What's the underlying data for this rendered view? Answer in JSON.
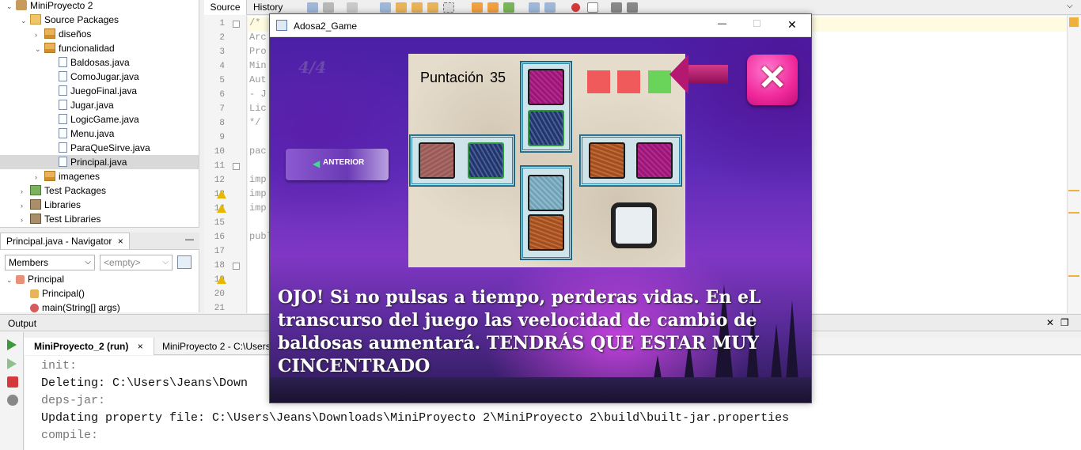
{
  "project_tree": {
    "items": [
      {
        "label": "MiniProyecto 2",
        "level": 0,
        "icon": "project-icon",
        "expanded": true
      },
      {
        "label": "Source Packages",
        "level": 1,
        "icon": "source-packages-icon",
        "expanded": true
      },
      {
        "label": "diseños",
        "level": 2,
        "icon": "package-icon",
        "expanded": false
      },
      {
        "label": "funcionalidad",
        "level": 2,
        "icon": "package-icon",
        "expanded": true
      },
      {
        "label": "Baldosas.java",
        "level": 3,
        "icon": "java-file-icon"
      },
      {
        "label": "ComoJugar.java",
        "level": 3,
        "icon": "java-file-icon"
      },
      {
        "label": "JuegoFinal.java",
        "level": 3,
        "icon": "java-file-icon"
      },
      {
        "label": "Jugar.java",
        "level": 3,
        "icon": "java-file-icon"
      },
      {
        "label": "LogicGame.java",
        "level": 3,
        "icon": "java-file-icon"
      },
      {
        "label": "Menu.java",
        "level": 3,
        "icon": "java-file-icon"
      },
      {
        "label": "ParaQueSirve.java",
        "level": 3,
        "icon": "java-file-icon"
      },
      {
        "label": "Principal.java",
        "level": 3,
        "icon": "java-main-file-icon",
        "selected": true
      },
      {
        "label": "imagenes",
        "level": 2,
        "icon": "package-icon",
        "expanded": false
      },
      {
        "label": "Test Packages",
        "level": 1,
        "icon": "test-packages-icon",
        "expanded": false
      },
      {
        "label": "Libraries",
        "level": 1,
        "icon": "libraries-icon",
        "expanded": false
      },
      {
        "label": "Test Libraries",
        "level": 1,
        "icon": "libraries-icon",
        "expanded": false
      }
    ]
  },
  "navigator": {
    "tab_label": "Principal.java - Navigator",
    "close": "×",
    "minimize": "—",
    "members_select": "Members",
    "filter_select": "<empty>",
    "items": [
      {
        "label": "Principal",
        "level": 0
      },
      {
        "label": "Principal()",
        "level": 1
      },
      {
        "label": "main(String[] args)",
        "level": 1
      }
    ]
  },
  "editor": {
    "tabs": [
      "Source",
      "History"
    ],
    "active_tab": "Source",
    "line_numbers": [
      "1",
      "2",
      "3",
      "4",
      "5",
      "6",
      "7",
      "8",
      "9",
      "10",
      "11",
      "12",
      "13",
      "14",
      "15",
      "16",
      "17",
      "18",
      "19",
      "20",
      "21"
    ],
    "code_lines": [
      "/*",
      "Arc",
      "Pro",
      "Min",
      "Aut",
      "- J",
      "Lic",
      " */",
      "",
      "pac",
      "",
      "imp",
      "imp",
      "imp",
      "",
      "publ",
      "",
      "",
      "",
      "",
      ""
    ]
  },
  "output": {
    "title": "Output",
    "tabs": [
      {
        "label": "MiniProyecto_2 (run)",
        "active": true,
        "close": "×"
      },
      {
        "label": "MiniProyecto 2 - C:\\Users",
        "active": false
      }
    ],
    "lines": [
      {
        "text": "init:",
        "muted": true
      },
      {
        "text": "Deleting: C:\\Users\\Jeans\\Down",
        "muted": false
      },
      {
        "text": "deps-jar:",
        "muted": true
      },
      {
        "text": "Updating property file: C:\\Users\\Jeans\\Downloads\\MiniProyecto 2\\MiniProyecto 2\\build\\built-jar.properties",
        "muted": false
      },
      {
        "text": "compile:",
        "muted": true
      }
    ]
  },
  "game_window": {
    "title": "Adosa2_Game",
    "controls": {
      "minimize": "—",
      "maximize": "☐",
      "close": "✕"
    },
    "level": "4/4",
    "back_button": "ANTERIOR",
    "score_label": "Puntación",
    "score_value": "35",
    "lives_colors": [
      "#f05a5a",
      "#f05a5a",
      "#6ad45a"
    ],
    "message": "OJO! Si no pulsas a tiempo, perderas vidas. En eL transcurso del juego las veelocidad de cambio de baldosas aumentará. TENDRÁS QUE ESTAR MUY CINCENTRADO",
    "colors": {
      "exit_button": "#f0289a",
      "arrow": "#a0145c",
      "group_border": "#2b7f9e"
    }
  }
}
